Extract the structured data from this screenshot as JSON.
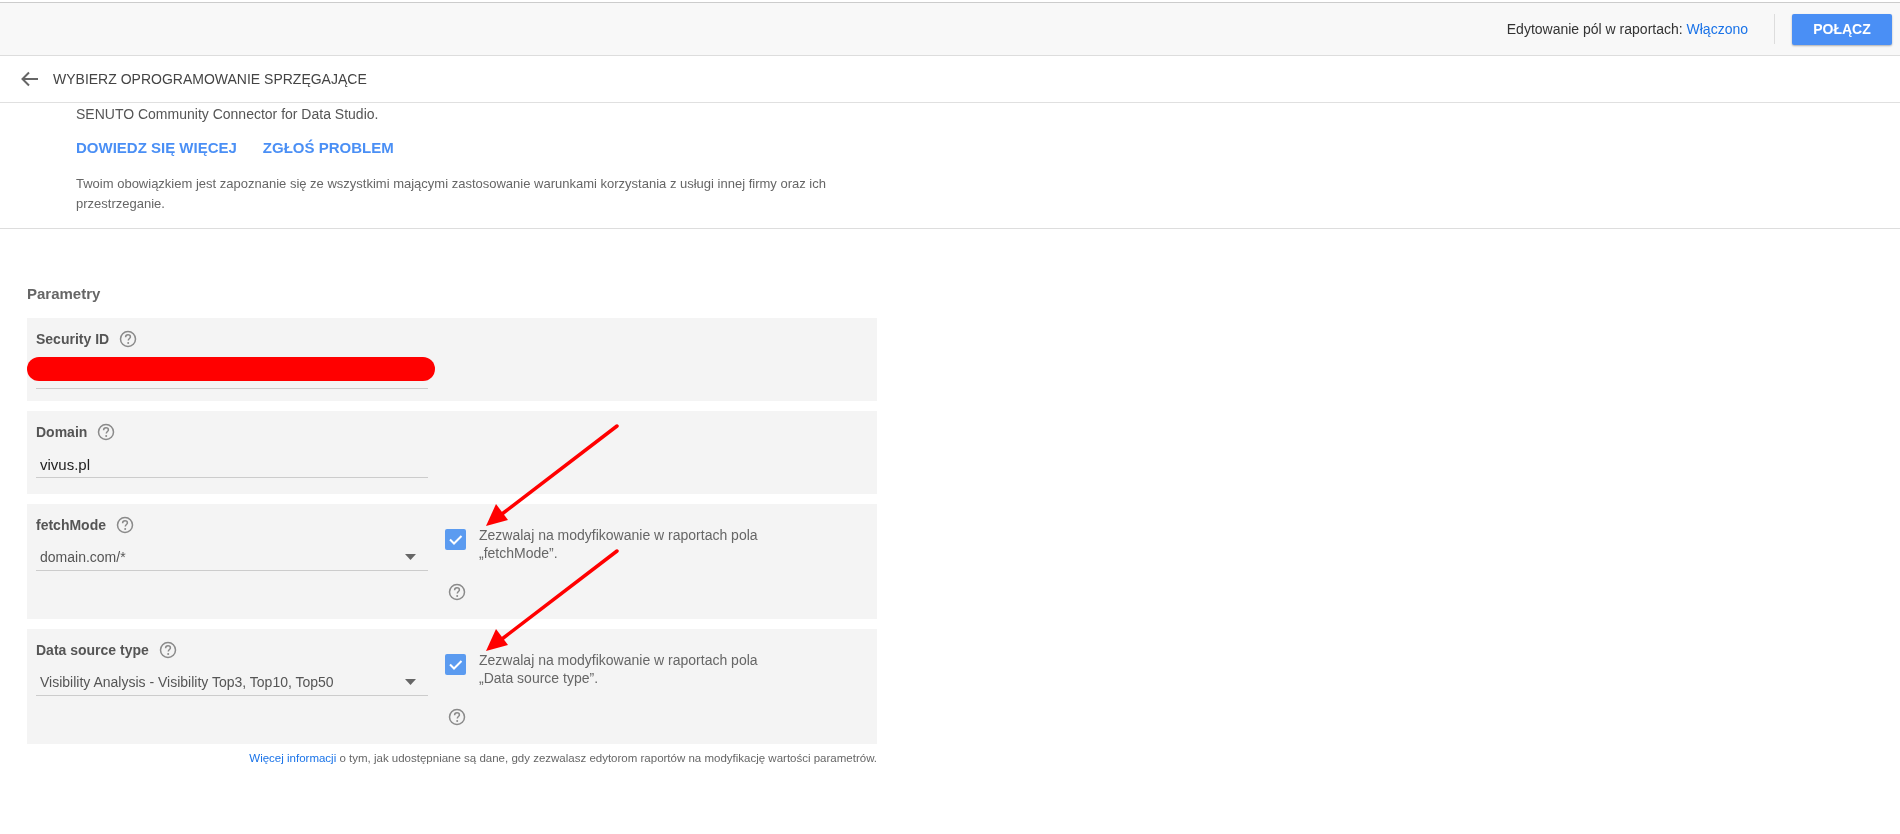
{
  "top_bar": {
    "edit_label": "Edytowanie pól w raportach:",
    "edit_state": "Włączono",
    "connect_button": "POŁĄCZ"
  },
  "header": {
    "title": "WYBIERZ OPROGRAMOWANIE SPRZĘGAJĄCE"
  },
  "connector": {
    "description": "SENUTO Community Connector for Data Studio.",
    "links": [
      "DOWIEDZ SIĘ WIĘCEJ",
      "ZGŁOŚ PROBLEM"
    ],
    "notice": "Twoim obowiązkiem jest zapoznanie się ze wszystkimi mającymi zastosowanie warunkami korzystania z usługi innej firmy oraz ich przestrzeganie."
  },
  "parameters": {
    "title": "Parametry",
    "items": [
      {
        "kind": "text",
        "label": "Security ID",
        "redacted": true
      },
      {
        "kind": "text",
        "label": "Domain",
        "value": "vivus.pl"
      },
      {
        "kind": "select",
        "label": "fetchMode",
        "value": "domain.com/*",
        "allow_edit": {
          "checked": true,
          "label": "Zezwalaj na modyfikowanie w raportach pola „fetchMode”.",
          "annotated": true
        }
      },
      {
        "kind": "select",
        "label": "Data source type",
        "value": "Visibility Analysis - Visibility Top3, Top10, Top50",
        "allow_edit": {
          "checked": true,
          "label": "Zezwalaj na modyfikowanie w raportach pola „Data source type”.",
          "annotated": true
        }
      }
    ],
    "footnote": {
      "link": "Więcej informacji",
      "text": "o tym, jak udostępniane są dane, gdy zezwalasz edytorom raportów na modyfikację wartości parametrów."
    }
  }
}
